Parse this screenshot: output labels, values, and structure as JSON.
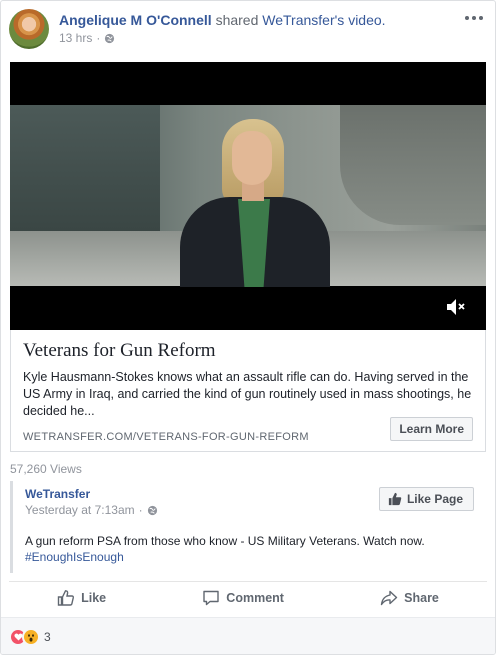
{
  "post": {
    "author": "Angelique M O'Connell",
    "shared_text": "shared",
    "shared_page": "WeTransfer's",
    "shared_type": "video.",
    "time": "13 hrs",
    "meta_separator": "·"
  },
  "link_preview": {
    "title": "Veterans for Gun Reform",
    "description": "Kyle Hausmann-Stokes knows what an assault rifle can do. Having served in the US Army in Iraq, and carried the kind of gun routinely used in mass shootings, he decided he...",
    "domain": "WETRANSFER.COM/VETERANS-FOR-GUN-REFORM",
    "cta_label": "Learn More"
  },
  "views": "57,260 Views",
  "original_post": {
    "page_name": "WeTransfer",
    "time": "Yesterday at 7:13am",
    "meta_separator": "·",
    "like_page_label": "Like Page",
    "text": "A gun reform PSA from those who know - US Military Veterans. Watch now.",
    "hashtag": "#EnoughIsEnough"
  },
  "actions": {
    "like": "Like",
    "comment": "Comment",
    "share": "Share"
  },
  "reactions": {
    "types": [
      "love",
      "wow"
    ],
    "count": "3"
  },
  "colors": {
    "link": "#365899",
    "muted": "#90949c",
    "love": "#f25268",
    "wow": "#f7b125"
  },
  "icons": {
    "more": "more-horizontal-icon",
    "privacy": "globe-icon",
    "mute": "speaker-muted-icon",
    "like": "thumbs-up-icon",
    "comment": "speech-bubble-icon",
    "share": "share-arrow-icon"
  }
}
